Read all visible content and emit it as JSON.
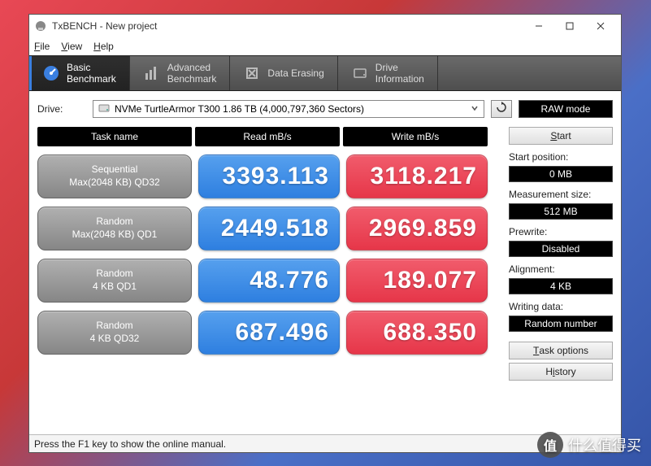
{
  "window": {
    "title": "TxBENCH - New project"
  },
  "menu": {
    "file": "File",
    "view": "View",
    "help": "Help"
  },
  "tabs": {
    "basic": "Basic\nBenchmark",
    "advanced": "Advanced\nBenchmark",
    "erasing": "Data Erasing",
    "info": "Drive\nInformation"
  },
  "drive": {
    "label": "Drive:",
    "value": "NVMe TurtleArmor T300  1.86 TB (4,000,797,360 Sectors)",
    "raw": "RAW mode"
  },
  "headers": {
    "task": "Task name",
    "read": "Read mB/s",
    "write": "Write mB/s"
  },
  "rows": [
    {
      "line1": "Sequential",
      "line2": "Max(2048 KB) QD32",
      "read": "3393.113",
      "write": "3118.217"
    },
    {
      "line1": "Random",
      "line2": "Max(2048 KB) QD1",
      "read": "2449.518",
      "write": "2969.859"
    },
    {
      "line1": "Random",
      "line2": "4 KB QD1",
      "read": "48.776",
      "write": "189.077"
    },
    {
      "line1": "Random",
      "line2": "4 KB QD32",
      "read": "687.496",
      "write": "688.350"
    }
  ],
  "side": {
    "start": "Start",
    "startpos_label": "Start position:",
    "startpos_value": "0 MB",
    "msize_label": "Measurement size:",
    "msize_value": "512 MB",
    "prewrite_label": "Prewrite:",
    "prewrite_value": "Disabled",
    "align_label": "Alignment:",
    "align_value": "4 KB",
    "wdata_label": "Writing data:",
    "wdata_value": "Random number",
    "taskopt": "Task options",
    "history": "History"
  },
  "statusbar": "Press the F1 key to show the online manual.",
  "watermark": {
    "badge": "值",
    "text": "什么值得买"
  }
}
